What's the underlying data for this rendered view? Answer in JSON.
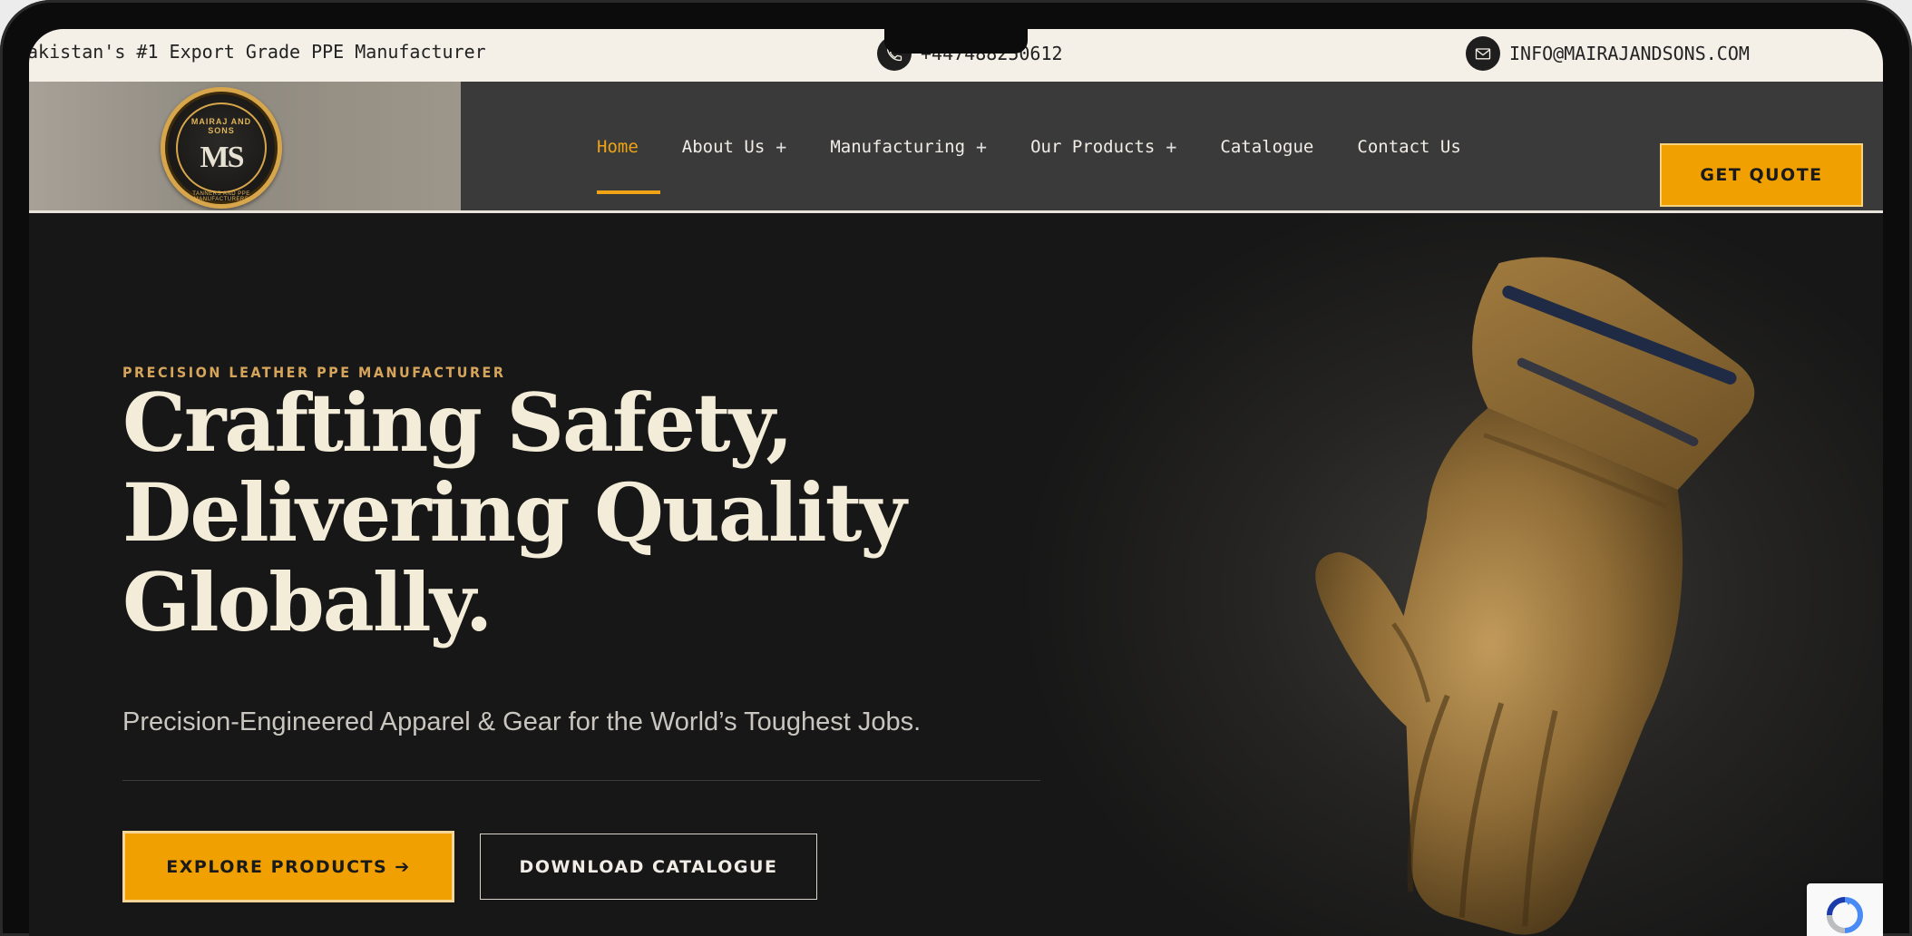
{
  "topbar": {
    "tagline": "akistan's #1 Export Grade PPE Manufacturer",
    "phone": "+447488250612",
    "email": "INFO@MAIRAJANDSONS.COM"
  },
  "logo": {
    "top_text": "MAIRAJ AND SONS",
    "monogram": "MS",
    "bottom_text": "TANNERS AND PPE MANUFACTURERS"
  },
  "nav": {
    "items": [
      {
        "label": "Home",
        "active": true,
        "has_submenu": false
      },
      {
        "label": "About Us",
        "active": false,
        "has_submenu": true
      },
      {
        "label": "Manufacturing",
        "active": false,
        "has_submenu": true
      },
      {
        "label": "Our Products",
        "active": false,
        "has_submenu": true
      },
      {
        "label": "Catalogue",
        "active": false,
        "has_submenu": false
      },
      {
        "label": "Contact Us",
        "active": false,
        "has_submenu": false
      }
    ],
    "submenu_symbol": "+",
    "cta": "GET QUOTE"
  },
  "hero": {
    "eyebrow": "PRECISION LEATHER PPE MANUFACTURER",
    "headline_line1": "Crafting Safety,",
    "headline_line2": "Delivering Quality",
    "headline_line3": "Globally.",
    "subhead": "Precision-Engineered Apparel & Gear for the World’s Toughest Jobs.",
    "primary_button": "EXPLORE PRODUCTS ➔",
    "secondary_button": "DOWNLOAD CATALOGUE"
  },
  "colors": {
    "accent": "#f0a000",
    "topbar_bg": "#f4efe7",
    "header_bg": "#3a3a3a",
    "hero_bg": "#171717",
    "headline": "#f3ecd8",
    "eyebrow": "#d6a55b"
  },
  "icons": {
    "phone": "phone-icon",
    "email": "envelope-icon",
    "hero_image": "leather-glove",
    "badge": "recaptcha-icon"
  }
}
